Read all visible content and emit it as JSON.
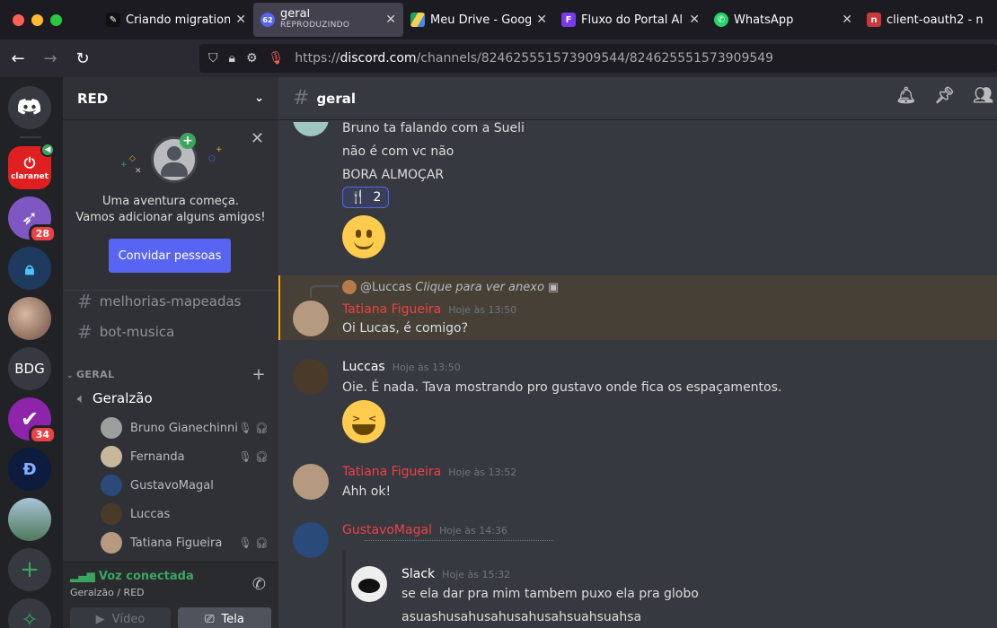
{
  "browser": {
    "tabs": [
      {
        "title": "Criando migration",
        "icon": "notion-icon",
        "color": "#000000"
      },
      {
        "title": "geral",
        "subtitle": "REPRODUZINDO",
        "icon": "discord-icon",
        "badge": "62",
        "color": "#5865f2"
      },
      {
        "title": "Meu Drive - Googl",
        "icon": "google-drive-icon",
        "color": "#1fa463"
      },
      {
        "title": "Fluxo do Portal Al",
        "icon": "figma-icon",
        "color": "#7c3aed"
      },
      {
        "title": "WhatsApp",
        "icon": "whatsapp-icon",
        "color": "#25d366"
      },
      {
        "title": "client-oauth2 - n",
        "icon": "npm-icon",
        "color": "#cb3837"
      }
    ],
    "url_prefix": "https://",
    "url_host": "discord.com",
    "url_path": "/channels/824625551573909544/824625551573909549"
  },
  "servers": {
    "items": [
      {
        "name": "discord-home",
        "label": "",
        "color": "#5865f2"
      },
      {
        "name": "claranet",
        "label": "claranet",
        "color": "#e02020"
      },
      {
        "name": "server-rocket",
        "label": "",
        "badge": "28",
        "color": "#7e57c2"
      },
      {
        "name": "server-lock",
        "label": "",
        "color": "#1e3a5f"
      },
      {
        "name": "server-photo",
        "label": "",
        "color": "#8d6e63"
      },
      {
        "name": "server-bdg",
        "label": "BDG",
        "color": "#36393f"
      },
      {
        "name": "server-check",
        "label": "",
        "badge": "34",
        "color": "#8e24aa"
      },
      {
        "name": "server-diablo",
        "label": "",
        "color": "#0d1b3e"
      },
      {
        "name": "server-landscape",
        "label": "",
        "color": "#4e7a5a"
      }
    ]
  },
  "guild": {
    "name": "RED",
    "invite": {
      "line1": "Uma aventura começa.",
      "line2": "Vamos adicionar alguns amigos!",
      "button": "Convidar pessoas"
    },
    "text_channels": [
      "melhorias-mapeadas",
      "bot-musica"
    ],
    "category": "GERAL",
    "voice_channel": "Geralzão",
    "voice_users": [
      {
        "name": "Bruno Gianechinni",
        "muted": true,
        "color": "#9e9e9e"
      },
      {
        "name": "Fernanda",
        "muted": true,
        "color": "#c8b89a"
      },
      {
        "name": "GustavoMagal",
        "muted": false,
        "color": "#2a4a7a"
      },
      {
        "name": "Luccas",
        "muted": false,
        "color": "#4a3a2a"
      },
      {
        "name": "Tatiana Figueira",
        "muted": true,
        "color": "#b59a80"
      }
    ],
    "voice_panel": {
      "status": "Voz conectada",
      "location": "Geralzão / RED",
      "video_label": "Vídeo",
      "screen_label": "Tela"
    }
  },
  "channel": {
    "name": "geral",
    "messages": {
      "cont_lines": [
        "Bruno ta falando com a Sueli",
        "não é com vc não",
        "BORA ALMOÇAR"
      ],
      "reaction": {
        "emoji": "🍴",
        "count": "2"
      },
      "reply_to": "@Luccas",
      "reply_hint": "Clique para ver anexo",
      "m1": {
        "author": "Tatiana Figueira",
        "time": "Hoje às 13:50",
        "text": "Oi Lucas, é comigo?",
        "color": "#ed4245"
      },
      "m2": {
        "author": "Luccas",
        "time": "Hoje às 13:50",
        "text": "Oie. É nada. Tava mostrando pro gustavo onde fica os espaçamentos.",
        "color": "#ffffff"
      },
      "m3": {
        "author": "Tatiana Figueira",
        "time": "Hoje às 13:52",
        "text": "Ahh ok!",
        "color": "#ed4245"
      },
      "m4": {
        "author": "GustavoMagal",
        "time": "Hoje às 14:36",
        "color": "#ed4245"
      },
      "m5": {
        "author": "Slack",
        "time": "Hoje às 15:32",
        "lines": [
          "se ela dar pra mim tambem puxo ela pra globo",
          "asuashusahusahusahusahsuahsuahsa"
        ],
        "color": "#ffffff"
      }
    }
  }
}
